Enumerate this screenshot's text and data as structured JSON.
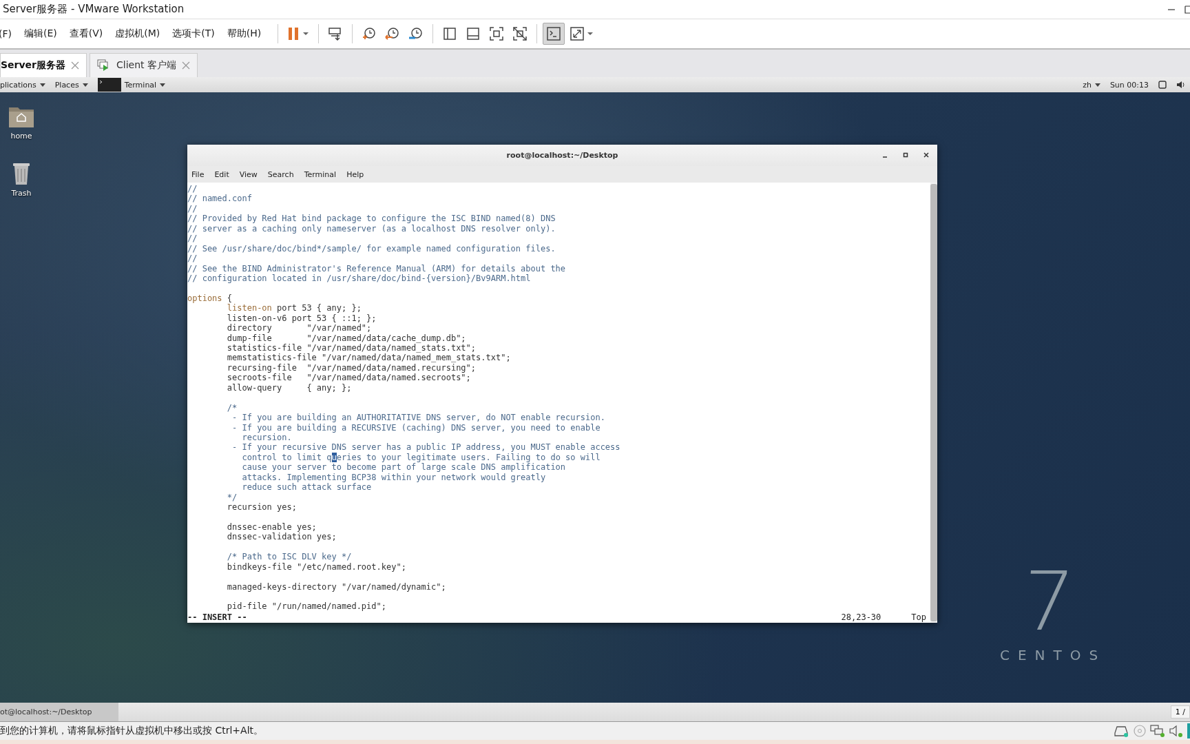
{
  "vmware": {
    "title": "Server服务器 - VMware Workstation",
    "menu": [
      "(F)",
      "编辑(E)",
      "查看(V)",
      "虚拟机(M)",
      "选项卡(T)",
      "帮助(H)"
    ],
    "toolbar": [
      {
        "kind": "pause",
        "selected": false
      },
      {
        "kind": "send-keys",
        "selected": false
      },
      {
        "kind": "snapshot",
        "selected": false
      },
      {
        "kind": "revert",
        "selected": false
      },
      {
        "kind": "manage",
        "selected": false
      },
      {
        "kind": "library",
        "selected": false
      },
      {
        "kind": "thumbnail",
        "selected": false
      },
      {
        "kind": "fullscreen",
        "selected": false
      },
      {
        "kind": "unity",
        "selected": false
      },
      {
        "kind": "console",
        "selected": true
      },
      {
        "kind": "stretch",
        "selected": false
      }
    ],
    "tabs": [
      {
        "label": "Server服务器",
        "selected": true,
        "kind": "server"
      },
      {
        "label": "Client 客户端",
        "selected": false,
        "kind": "client"
      }
    ]
  },
  "guest_top_bar": {
    "menus": [
      {
        "label": "plications",
        "kind": "text"
      },
      {
        "label": "Places",
        "kind": "text"
      },
      {
        "label": "Terminal",
        "kind": "terminal"
      }
    ],
    "input_source": "zh",
    "clock": "Sun 00:13"
  },
  "desktop_icons": [
    {
      "label": "home",
      "kind": "home"
    },
    {
      "label": "Trash",
      "kind": "trash"
    }
  ],
  "terminal": {
    "title": "root@localhost:~/Desktop",
    "menu": [
      "File",
      "Edit",
      "View",
      "Search",
      "Terminal",
      "Help"
    ],
    "lines": [
      {
        "kind": "code",
        "segments": [
          {
            "text": "//",
            "kind": "comment"
          }
        ]
      },
      {
        "kind": "code",
        "segments": [
          {
            "text": "// named.conf",
            "kind": "comment"
          }
        ]
      },
      {
        "kind": "code",
        "segments": [
          {
            "text": "//",
            "kind": "comment"
          }
        ]
      },
      {
        "kind": "code",
        "segments": [
          {
            "text": "// Provided by Red Hat bind package to configure the ISC BIND named(8) DNS",
            "kind": "comment"
          }
        ]
      },
      {
        "kind": "code",
        "segments": [
          {
            "text": "// server as a caching only nameserver (as a localhost DNS resolver only).",
            "kind": "comment"
          }
        ]
      },
      {
        "kind": "code",
        "segments": [
          {
            "text": "//",
            "kind": "comment"
          }
        ]
      },
      {
        "kind": "code",
        "segments": [
          {
            "text": "// See /usr/share/doc/bind*/sample/ for example named configuration files.",
            "kind": "comment"
          }
        ]
      },
      {
        "kind": "code",
        "segments": [
          {
            "text": "//",
            "kind": "comment"
          }
        ]
      },
      {
        "kind": "code",
        "segments": [
          {
            "text": "// See the BIND Administrator's Reference Manual (ARM) for details about the",
            "kind": "comment"
          }
        ]
      },
      {
        "kind": "code",
        "segments": [
          {
            "text": "// configuration located in /usr/share/doc/bind-{version}/Bv9ARM.html",
            "kind": "comment"
          }
        ]
      },
      {
        "kind": "blank"
      },
      {
        "kind": "code",
        "segments": [
          {
            "text": "options",
            "kind": "keyword"
          },
          {
            "text": " {",
            "kind": "plain"
          }
        ]
      },
      {
        "kind": "code",
        "segments": [
          {
            "text": "        listen-on",
            "kind": "keyword"
          },
          {
            "text": " port 53 { any; };",
            "kind": "plain"
          }
        ]
      },
      {
        "kind": "code",
        "segments": [
          {
            "text": "        listen-on-v6 port 53 { ::1; };",
            "kind": "plain"
          }
        ]
      },
      {
        "kind": "code",
        "segments": [
          {
            "text": "        directory       \"/var/named\";",
            "kind": "plain"
          }
        ]
      },
      {
        "kind": "code",
        "segments": [
          {
            "text": "        dump-file       \"/var/named/data/cache_dump.db\";",
            "kind": "plain"
          }
        ]
      },
      {
        "kind": "code",
        "segments": [
          {
            "text": "        statistics-file \"/var/named/data/named_stats.txt\";",
            "kind": "plain"
          }
        ]
      },
      {
        "kind": "code",
        "segments": [
          {
            "text": "        memstatistics-file \"/var/named/data/named_mem_stats.txt\";",
            "kind": "plain"
          }
        ]
      },
      {
        "kind": "code",
        "segments": [
          {
            "text": "        recursing-file  \"/var/named/data/named.recursing\";",
            "kind": "plain"
          }
        ]
      },
      {
        "kind": "code",
        "segments": [
          {
            "text": "        secroots-file   \"/var/named/data/named.secroots\";",
            "kind": "plain"
          }
        ]
      },
      {
        "kind": "code",
        "segments": [
          {
            "text": "        allow-query     { any; };",
            "kind": "plain"
          }
        ]
      },
      {
        "kind": "blank"
      },
      {
        "kind": "code",
        "segments": [
          {
            "text": "        /*",
            "kind": "comment"
          }
        ]
      },
      {
        "kind": "code",
        "segments": [
          {
            "text": "         - If you are building an AUTHORITATIVE DNS server, do NOT enable recursion.",
            "kind": "comment"
          }
        ]
      },
      {
        "kind": "code",
        "segments": [
          {
            "text": "         - If you are building a RECURSIVE (caching) DNS server, you need to enable",
            "kind": "comment"
          }
        ]
      },
      {
        "kind": "code",
        "segments": [
          {
            "text": "           recursion.",
            "kind": "comment"
          }
        ]
      },
      {
        "kind": "code",
        "segments": [
          {
            "text": "         - If your recursive DNS server has a public IP address, you MUST enable access",
            "kind": "comment"
          }
        ]
      },
      {
        "kind": "code",
        "segments": [
          {
            "text": "           control to limit q",
            "kind": "comment"
          },
          {
            "text": "u",
            "kind": "cursor"
          },
          {
            "text": "eries to your legitimate users. Failing to do so will",
            "kind": "comment"
          }
        ]
      },
      {
        "kind": "code",
        "segments": [
          {
            "text": "           cause your server to become part of large scale DNS amplification",
            "kind": "comment"
          }
        ]
      },
      {
        "kind": "code",
        "segments": [
          {
            "text": "           attacks. Implementing BCP38 within your network would greatly",
            "kind": "comment"
          }
        ]
      },
      {
        "kind": "code",
        "segments": [
          {
            "text": "           reduce such attack surface",
            "kind": "comment"
          }
        ]
      },
      {
        "kind": "code",
        "segments": [
          {
            "text": "        */",
            "kind": "comment"
          }
        ]
      },
      {
        "kind": "code",
        "segments": [
          {
            "text": "        recursion yes;",
            "kind": "plain"
          }
        ]
      },
      {
        "kind": "blank"
      },
      {
        "kind": "code",
        "segments": [
          {
            "text": "        dnssec-enable yes;",
            "kind": "plain"
          }
        ]
      },
      {
        "kind": "code",
        "segments": [
          {
            "text": "        dnssec-validation yes;",
            "kind": "plain"
          }
        ]
      },
      {
        "kind": "blank"
      },
      {
        "kind": "code",
        "segments": [
          {
            "text": "        /* Path to ISC DLV key */",
            "kind": "comment"
          }
        ]
      },
      {
        "kind": "code",
        "segments": [
          {
            "text": "        bindkeys-file \"/etc/named.root.key\";",
            "kind": "plain"
          }
        ]
      },
      {
        "kind": "blank"
      },
      {
        "kind": "code",
        "segments": [
          {
            "text": "        managed-keys-directory \"/var/named/dynamic\";",
            "kind": "plain"
          }
        ]
      },
      {
        "kind": "blank"
      },
      {
        "kind": "code",
        "segments": [
          {
            "text": "        pid-file \"/run/named/named.pid\";",
            "kind": "plain"
          }
        ]
      }
    ],
    "status": {
      "mode": "-- INSERT --",
      "position": "28,23-30",
      "scroll": "Top"
    }
  },
  "branding": {
    "version": "7",
    "name": "CENTOS"
  },
  "taskbar": {
    "window": "ot@localhost:~/Desktop",
    "workspace": "1 /"
  },
  "status_bar": {
    "message": "到您的计算机，请将鼠标指针从虚拟机中移出或按 Ctrl+Alt。",
    "devices": [
      {
        "kind": "disk"
      },
      {
        "kind": "cd"
      },
      {
        "kind": "network"
      },
      {
        "kind": "sound"
      }
    ]
  }
}
